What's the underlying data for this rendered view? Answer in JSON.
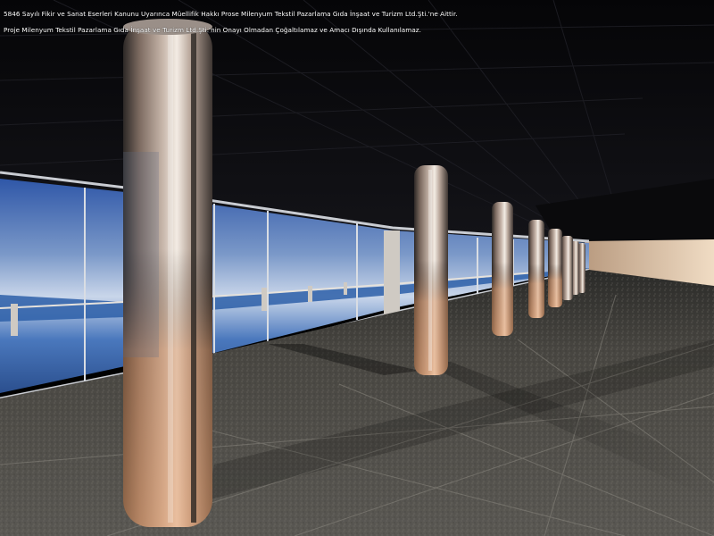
{
  "image": {
    "subject": "rendered interior colonnade",
    "caption_lines": [
      "5846 Sayılı Fikir ve Sanat Eserleri Kanunu Uyarınca Müellifik Hakkı Prose Milenyum Tekstil Pazarlama Gıda İnşaat ve Turizm Ltd.Şti.'ne Aittir.",
      "Proje Milenyum Tekstil Pazarlama Gıda İnşaat ve Turizm Ltd.Şti.'nin Onayı Olmadan Çoğaltılamaz ve Amacı Dışında Kullanılamaz."
    ]
  },
  "colors": {
    "ceiling": "#0b0b0f",
    "sky_top": "#2f57a8",
    "sky_mid": "#9fb6d8",
    "sea": "#3d6fb8",
    "floor": "#4b4a46",
    "column_warm": "#d08a5a",
    "column_light": "#f1e7dc",
    "wall_far": "#e6cfb3"
  }
}
